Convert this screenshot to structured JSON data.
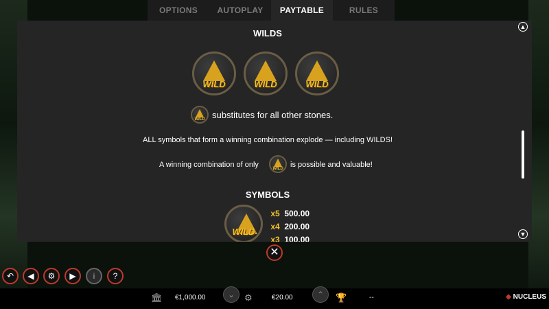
{
  "tabs": [
    "OPTIONS",
    "AUTOPLAY",
    "PAYTABLE",
    "RULES"
  ],
  "wilds": {
    "heading": "WILDS",
    "coin_label": "WILD",
    "substitutes_text": "substitutes for all other stones.",
    "explode_text": "ALL symbols that form a winning combination explode — including WILDS!",
    "combo_prefix": "A winning combination of only",
    "combo_suffix": "is possible and valuable!"
  },
  "symbols": {
    "heading": "SYMBOLS",
    "coin_label": "WILD",
    "payouts": [
      {
        "mult": "x5",
        "value": "500.00"
      },
      {
        "mult": "x4",
        "value": "200.00"
      },
      {
        "mult": "x3",
        "value": "100.00"
      }
    ]
  },
  "status": {
    "balance": "€1,000.00",
    "bet": "€20.00",
    "win": "--",
    "brand": "NUCLEUS"
  },
  "icons": {
    "accent": "#c0392b",
    "gold": "#f2c12e"
  }
}
